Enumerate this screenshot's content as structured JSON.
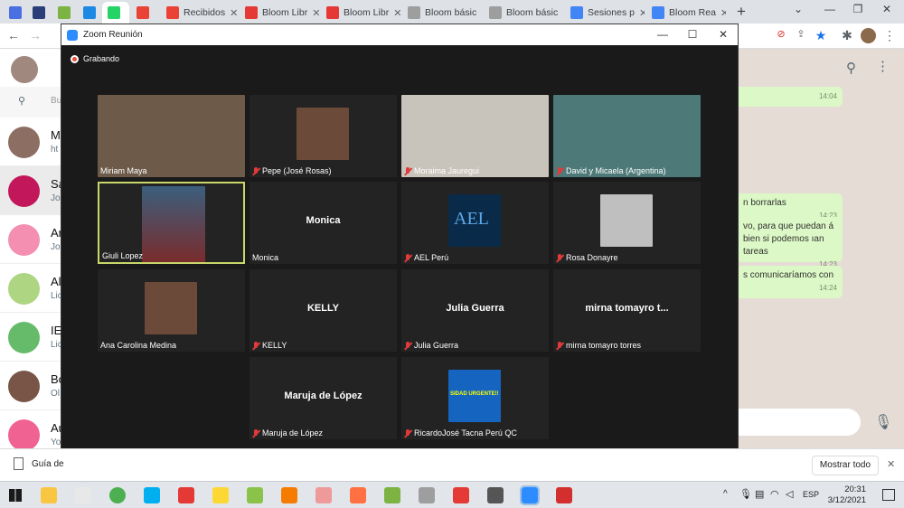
{
  "browser": {
    "tabs": [
      {
        "label": "",
        "color": "#4a6fe3",
        "icon": "v-icon"
      },
      {
        "label": "",
        "color": "#2a3f7a",
        "icon": "shield-icon"
      },
      {
        "label": "",
        "color": "#7cb342",
        "icon": "leaf-icon"
      },
      {
        "label": "",
        "color": "#1e88e5",
        "icon": "calendar-icon"
      },
      {
        "label": "",
        "color": "#25d366",
        "icon": "whatsapp-icon"
      },
      {
        "label": "",
        "color": "#ea4335",
        "icon": "gmail-icon"
      },
      {
        "label": "Recibidos",
        "color": "#ea4335",
        "icon": "gmail-icon"
      },
      {
        "label": "Bloom Libr",
        "color": "#e53935",
        "icon": "bloom-icon"
      },
      {
        "label": "Bloom Libr",
        "color": "#e53935",
        "icon": "bloom-icon"
      },
      {
        "label": "Bloom básic",
        "color": "#9e9e9e",
        "icon": "doc-icon"
      },
      {
        "label": "Bloom básic",
        "color": "#9e9e9e",
        "icon": "doc-icon"
      },
      {
        "label": "Sesiones p",
        "color": "#4285f4",
        "icon": "docs-icon"
      },
      {
        "label": "Bloom Rea",
        "color": "#4285f4",
        "icon": "play-icon"
      }
    ],
    "new_tab": "+",
    "win_controls": {
      "dropdown": "⌄",
      "minimize": "—",
      "maximize": "❐",
      "close": "✕"
    }
  },
  "whatsapp": {
    "search_placeholder": "Bu",
    "chats": [
      {
        "name": "M",
        "snippet": "ht",
        "color": "#8d6e63"
      },
      {
        "name": "Sa",
        "snippet": "Jo",
        "color": "#c2185b"
      },
      {
        "name": "Ar",
        "snippet": "Jo",
        "color": "#f48fb1"
      },
      {
        "name": "Al",
        "snippet": "Lic",
        "color": "#aed581"
      },
      {
        "name": "IE",
        "snippet": "Lic",
        "color": "#66bb6a"
      },
      {
        "name": "Bo",
        "snippet": "Ol",
        "color": "#795548"
      },
      {
        "name": "Au",
        "snippet": "Yo",
        "color": "#f06292"
      }
    ],
    "messages": [
      {
        "text": "",
        "time": "14:04"
      },
      {
        "text": "n borrarlas",
        "time": "14:23"
      },
      {
        "text": "vo, para que puedan á bien si podemos ıan tareas",
        "time": "14:23"
      },
      {
        "text": "s comunicaríamos con",
        "time": "14:24"
      }
    ]
  },
  "zoom": {
    "title": "Zoom Reunión",
    "recording": "Grabando",
    "controls": {
      "minimize": "—",
      "maximize": "☐",
      "close": "✕"
    },
    "participants": [
      {
        "name": "Miriam Maya",
        "muted": false,
        "display": "video"
      },
      {
        "name": "Pepe (José Rosas)",
        "muted": true,
        "display": "photo"
      },
      {
        "name": "Moraima Jauregui",
        "muted": true,
        "display": "video"
      },
      {
        "name": "David y Micaela (Argentina)",
        "muted": true,
        "display": "video"
      },
      {
        "name": "Giuli Lopez",
        "muted": false,
        "display": "video",
        "active_speaker": true
      },
      {
        "name": "Monica",
        "muted": false,
        "display": "name",
        "big_label": "Monica"
      },
      {
        "name": "AEL Perú",
        "muted": true,
        "display": "photo"
      },
      {
        "name": "Rosa Donayre",
        "muted": true,
        "display": "photo"
      },
      {
        "name": "Ana Carolina Medina",
        "muted": false,
        "display": "photo"
      },
      {
        "name": "KELLY",
        "muted": true,
        "display": "name",
        "big_label": "KELLY"
      },
      {
        "name": "Julia Guerra",
        "muted": true,
        "display": "name",
        "big_label": "Julia Guerra"
      },
      {
        "name": "mirna tomayro torres",
        "muted": true,
        "display": "name",
        "big_label": "mirna tomayro t..."
      },
      {
        "name": "Maruja de López",
        "muted": true,
        "display": "name",
        "big_label": "Maruja de López"
      },
      {
        "name": "RicardoJosé Tacna Perú QC",
        "muted": true,
        "display": "photo"
      }
    ],
    "photo_texts": {
      "ael": "AEL",
      "ricardo": "SIDAD URGENTE!!"
    }
  },
  "downloads": {
    "file": "Guía de",
    "show_all": "Mostrar todo",
    "close": "✕"
  },
  "taskbar": {
    "language": "ESP",
    "time": "20:31",
    "date": "3/12/2021",
    "tray": "^"
  }
}
